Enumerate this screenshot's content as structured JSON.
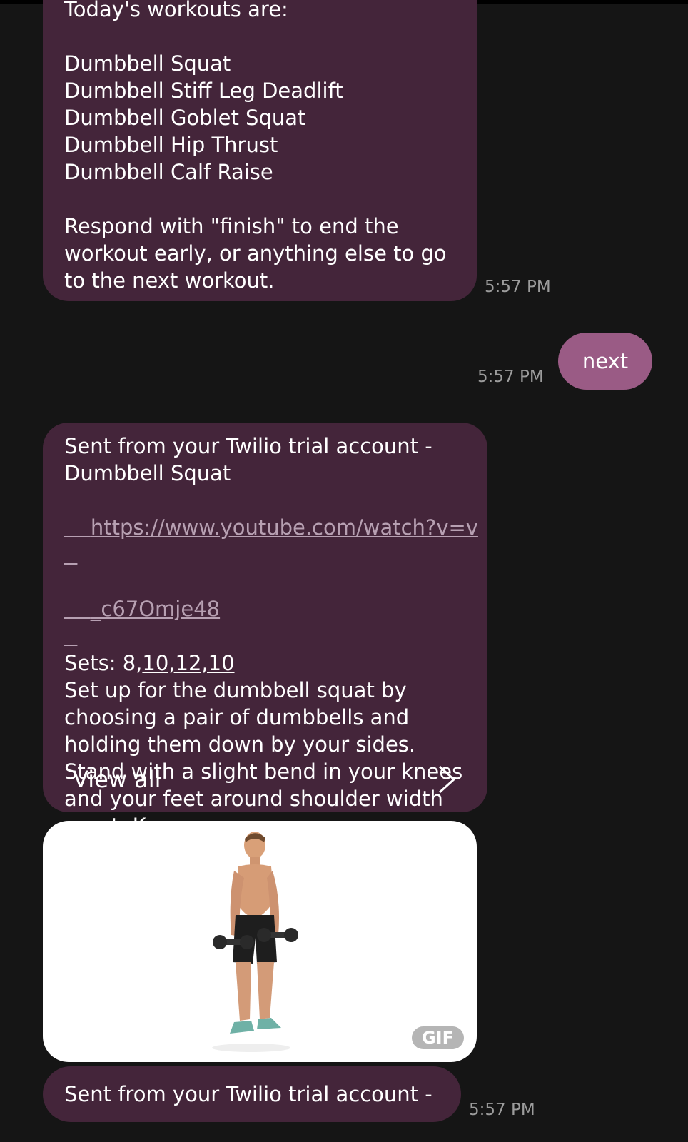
{
  "conversation": {
    "message1": {
      "lines": [
        "Today's workouts are:",
        "",
        "Dumbbell Squat",
        "Dumbbell Stiff Leg Deadlift",
        "Dumbbell Goblet Squat",
        "Dumbbell Hip Thrust",
        "Dumbbell Calf Raise",
        "",
        "Respond with \"finish\" to end the",
        "workout early, or anything else to go",
        "to the next workout."
      ],
      "time": "5:57 PM"
    },
    "outgoing": {
      "text": "next",
      "time": "5:57 PM"
    },
    "message2": {
      "line1": "Sent from your Twilio trial account -",
      "line2": "Dumbbell Squat",
      "link_line1": "https://www.youtube.com/watch?v=v",
      "link_line2": "_c67Omje48",
      "sets_label": "Sets: 8,",
      "sets_values": "10,12,10",
      "body_lines": [
        "Set up for the dumbbell squat by",
        "choosing a pair of dumbbells and",
        "holding them down by your sides.",
        "Stand with a slight bend in your knees",
        "and your feet around shoulder width",
        "apart. Keep"
      ],
      "view_all": "View all"
    },
    "media": {
      "badge": "GIF"
    },
    "message3": {
      "text": "Sent from your Twilio trial account -",
      "time": "5:57 PM"
    }
  },
  "colors": {
    "background": "#151515",
    "incoming_bubble": "#44253a",
    "outgoing_bubble": "#9a5b85",
    "link": "#b7a0b2",
    "timestamp": "#9c9c9c"
  },
  "icons": {
    "view_all": "chevron-right-icon"
  }
}
